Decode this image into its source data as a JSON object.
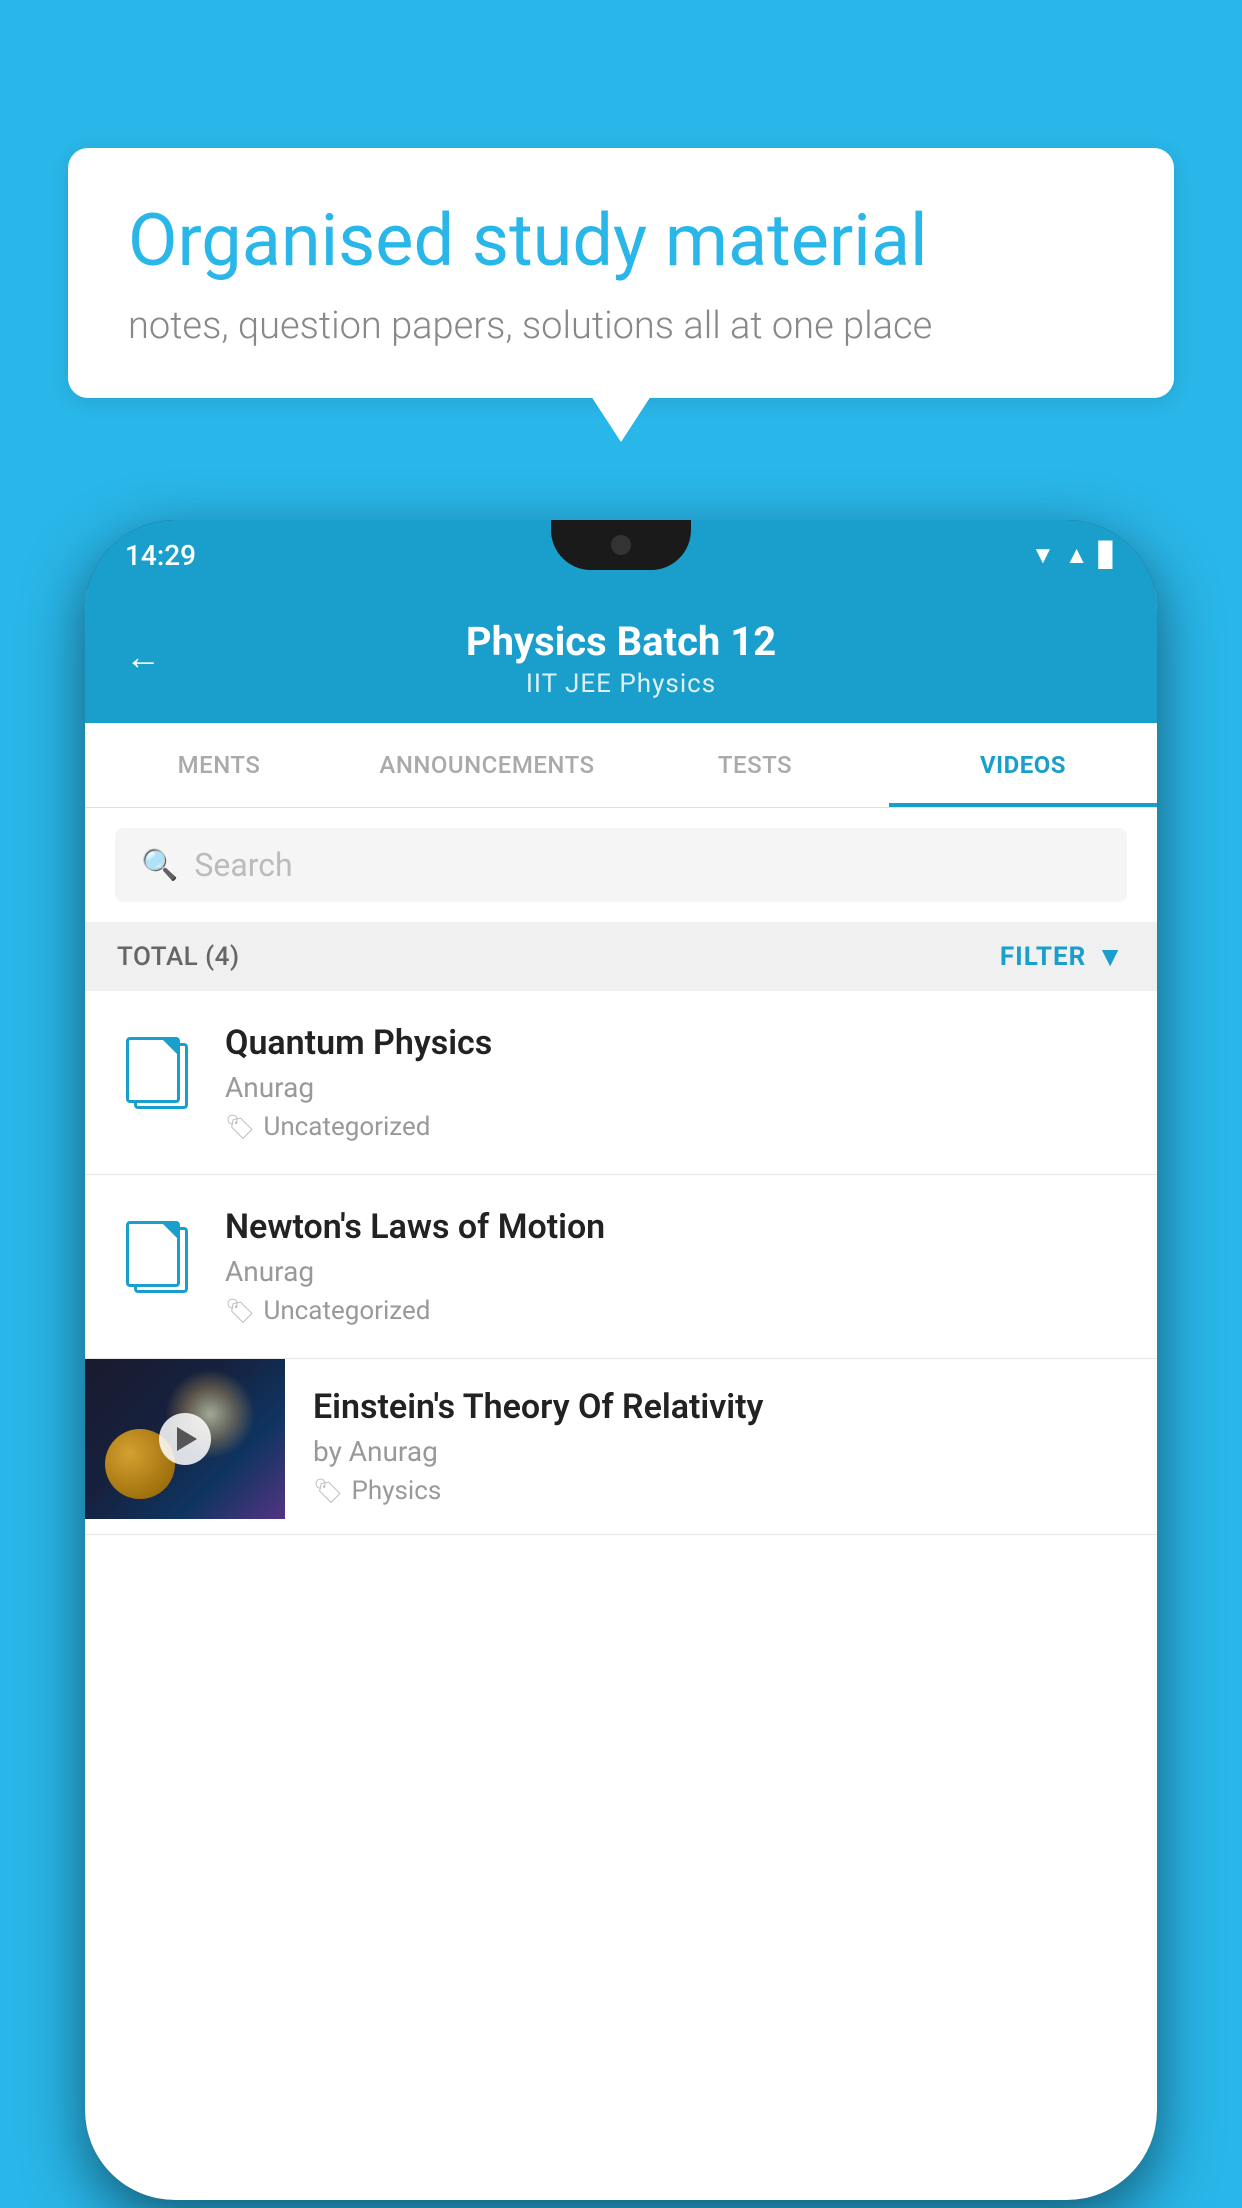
{
  "background_color": "#29b6e8",
  "speech_bubble": {
    "title": "Organised study material",
    "subtitle": "notes, question papers, solutions all at one place"
  },
  "phone": {
    "status_bar": {
      "time": "14:29",
      "icons": [
        "wifi",
        "signal",
        "battery"
      ]
    },
    "header": {
      "back_label": "←",
      "title": "Physics Batch 12",
      "subtitle": "IIT JEE    Physics"
    },
    "tabs": [
      {
        "label": "MENTS",
        "active": false
      },
      {
        "label": "ANNOUNCEMENTS",
        "active": false
      },
      {
        "label": "TESTS",
        "active": false
      },
      {
        "label": "VIDEOS",
        "active": true
      }
    ],
    "search": {
      "placeholder": "Search"
    },
    "filter_bar": {
      "total_label": "TOTAL (4)",
      "filter_label": "FILTER"
    },
    "list_items": [
      {
        "title": "Quantum Physics",
        "author": "Anurag",
        "tag": "Uncategorized",
        "has_thumbnail": false
      },
      {
        "title": "Newton's Laws of Motion",
        "author": "Anurag",
        "tag": "Uncategorized",
        "has_thumbnail": false
      },
      {
        "title": "Einstein's Theory Of Relativity",
        "author": "by Anurag",
        "tag": "Physics",
        "has_thumbnail": true
      }
    ]
  }
}
